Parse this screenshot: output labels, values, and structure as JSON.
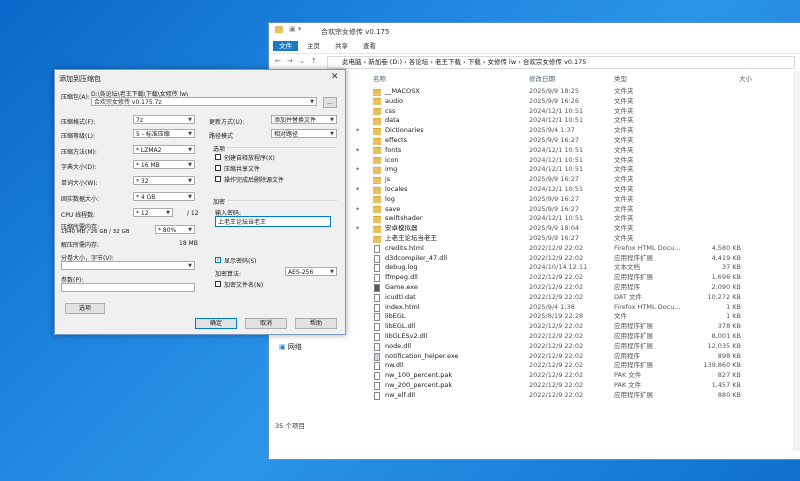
{
  "explorer": {
    "title": "合欢宗女修传 v0.175",
    "ribbon_tabs": [
      "文件",
      "主页",
      "共享",
      "查看"
    ],
    "breadcrumb": "此电脑 › 新加卷 (D:) › 各论坛 › 老王下载 › 下载 › 女修传 lw › 合欢宗女修传 v0.175",
    "columns": [
      "名称",
      "修改日期",
      "类型",
      "大小"
    ],
    "sidebar_network": "网络",
    "status": "35 个项目",
    "files": [
      {
        "name": "__MACOSX",
        "date": "2025/9/9 18:25",
        "type": "文件夹",
        "size": "",
        "kind": "folder"
      },
      {
        "name": "audio",
        "date": "2025/9/9 16:26",
        "type": "文件夹",
        "size": "",
        "kind": "folder"
      },
      {
        "name": "css",
        "date": "2024/12/1 10:51",
        "type": "文件夹",
        "size": "",
        "kind": "folder"
      },
      {
        "name": "data",
        "date": "2024/12/1 10:51",
        "type": "文件夹",
        "size": "",
        "kind": "folder"
      },
      {
        "name": "Dictionaries",
        "date": "2025/9/4 1:37",
        "type": "文件夹",
        "size": "",
        "kind": "folder"
      },
      {
        "name": "effects",
        "date": "2025/9/9 16:27",
        "type": "文件夹",
        "size": "",
        "kind": "folder"
      },
      {
        "name": "fonts",
        "date": "2024/12/1 10:51",
        "type": "文件夹",
        "size": "",
        "kind": "folder"
      },
      {
        "name": "icon",
        "date": "2024/12/1 10:51",
        "type": "文件夹",
        "size": "",
        "kind": "folder"
      },
      {
        "name": "img",
        "date": "2024/12/1 10:51",
        "type": "文件夹",
        "size": "",
        "kind": "folder"
      },
      {
        "name": "js",
        "date": "2025/9/9 16:27",
        "type": "文件夹",
        "size": "",
        "kind": "folder"
      },
      {
        "name": "locales",
        "date": "2024/12/1 10:51",
        "type": "文件夹",
        "size": "",
        "kind": "folder"
      },
      {
        "name": "log",
        "date": "2025/9/9 16:27",
        "type": "文件夹",
        "size": "",
        "kind": "folder"
      },
      {
        "name": "save",
        "date": "2025/9/9 16:27",
        "type": "文件夹",
        "size": "",
        "kind": "folder"
      },
      {
        "name": "swiftshader",
        "date": "2024/12/1 10:51",
        "type": "文件夹",
        "size": "",
        "kind": "folder"
      },
      {
        "name": "安卓模拟器",
        "date": "2025/9/9 18:04",
        "type": "文件夹",
        "size": "",
        "kind": "folder"
      },
      {
        "name": "上老王论坛当老王",
        "date": "2025/9/9 16:27",
        "type": "文件夹",
        "size": "",
        "kind": "folder"
      },
      {
        "name": "credits.html",
        "date": "2022/12/9 22:02",
        "type": "Firefox HTML Docu...",
        "size": "4,580 KB",
        "kind": "file"
      },
      {
        "name": "d3dcompiler_47.dll",
        "date": "2022/12/9 22:02",
        "type": "应用程序扩展",
        "size": "4,419 KB",
        "kind": "file"
      },
      {
        "name": "debug.log",
        "date": "2024/10/14 12:11",
        "type": "文本文档",
        "size": "37 KB",
        "kind": "file"
      },
      {
        "name": "ffmpeg.dll",
        "date": "2022/12/9 22:02",
        "type": "应用程序扩展",
        "size": "1,696 KB",
        "kind": "file"
      },
      {
        "name": "Game.exe",
        "date": "2022/12/9 22:02",
        "type": "应用程序",
        "size": "2,090 KB",
        "kind": "dark"
      },
      {
        "name": "icudtl.dat",
        "date": "2022/12/9 22:02",
        "type": "DAT 文件",
        "size": "10,272 KB",
        "kind": "file"
      },
      {
        "name": "index.html",
        "date": "2025/9/4 1:38",
        "type": "Firefox HTML Docu...",
        "size": "1 KB",
        "kind": "file"
      },
      {
        "name": "libEGL",
        "date": "2025/8/19 22:28",
        "type": "文件",
        "size": "1 KB",
        "kind": "file"
      },
      {
        "name": "libEGL.dll",
        "date": "2022/12/9 22:02",
        "type": "应用程序扩展",
        "size": "378 KB",
        "kind": "file"
      },
      {
        "name": "libGLESv2.dll",
        "date": "2022/12/9 22:02",
        "type": "应用程序扩展",
        "size": "8,001 KB",
        "kind": "file"
      },
      {
        "name": "node.dll",
        "date": "2022/12/9 22:02",
        "type": "应用程序扩展",
        "size": "12,035 KB",
        "kind": "file"
      },
      {
        "name": "notification_helper.exe",
        "date": "2022/12/9 22:02",
        "type": "应用程序",
        "size": "898 KB",
        "kind": "app"
      },
      {
        "name": "nw.dll",
        "date": "2022/12/9 22:02",
        "type": "应用程序扩展",
        "size": "139,860 KB",
        "kind": "file"
      },
      {
        "name": "nw_100_percent.pak",
        "date": "2022/12/9 22:02",
        "type": "PAK 文件",
        "size": "827 KB",
        "kind": "file"
      },
      {
        "name": "nw_200_percent.pak",
        "date": "2022/12/9 22:02",
        "type": "PAK 文件",
        "size": "1,457 KB",
        "kind": "file"
      },
      {
        "name": "nw_elf.dll",
        "date": "2022/12/9 22:02",
        "type": "应用程序扩展",
        "size": "880 KB",
        "kind": "file"
      }
    ]
  },
  "dialog": {
    "title": "添加到压缩包",
    "archive_label": "压缩包(A):",
    "archive_path": "D:\\各论坛\\老王下载\\下载\\女修传 lw\\",
    "archive_name": "合欢宗女修传 v0.175.7z",
    "browse_label": "...",
    "format_label": "压缩格式(F):",
    "format_value": "7z",
    "level_label": "压缩等级(L):",
    "level_value": "5 - 标准压缩",
    "method_label": "压缩方法(M):",
    "method_value": "* LZMA2",
    "dict_label": "字典大小(D):",
    "dict_value": "* 16 MB",
    "word_label": "单词大小(W):",
    "word_value": "* 32",
    "solid_label": "固实数据大小:",
    "solid_value": "* 4 GB",
    "threads_label": "CPU 线程数:",
    "threads_value": "* 12",
    "threads_total": "/ 12",
    "mem_comp_label": "压缩所需内存:",
    "mem_comp_detail": "1840 MB / 26 GB / 32 GB",
    "mem_pct_value": "* 80%",
    "mem_decomp_label": "解压所需内存:",
    "mem_decomp_value": "18 MB",
    "split_label": "分卷大小，字节(V):",
    "params_label": "参数(P):",
    "options_button": "选项",
    "update_label": "更新方式(U):",
    "update_value": "添加并替换文件",
    "pathmode_label": "路径模式",
    "pathmode_value": "相对路径",
    "options_group": "选项",
    "opt_sfx": "创建自释放程序(X)",
    "opt_shared": "压缩共享文件",
    "opt_delete": "操作完成后删除源文件",
    "encrypt_group": "加密",
    "password_label": "输入密码:",
    "password_value": "上老王论坛当老王",
    "show_password": "显示密码(S)",
    "enc_method_label": "加密算法:",
    "enc_method_value": "AES-256",
    "encrypt_names": "加密文件名(N)",
    "ok_button": "确定",
    "cancel_button": "取消",
    "help_button": "帮助",
    "close_glyph": "✕"
  }
}
